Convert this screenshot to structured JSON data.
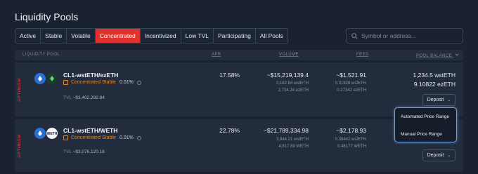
{
  "page": {
    "title": "Liquidity Pools"
  },
  "tabs": [
    {
      "label": "Active"
    },
    {
      "label": "Stable"
    },
    {
      "label": "Volatile"
    },
    {
      "label": "Concentrated"
    },
    {
      "label": "Incentivized"
    },
    {
      "label": "Low TVL"
    },
    {
      "label": "Participating"
    },
    {
      "label": "All Pools"
    }
  ],
  "active_tab": "Concentrated",
  "search": {
    "placeholder": "Symbol or address...",
    "value": ""
  },
  "table": {
    "headers": {
      "pool": "LIQUIDITY POOL",
      "apr": "APR",
      "volume": "VOLUME",
      "fees": "FEES",
      "balance": "POOL BALANCE"
    }
  },
  "rows": [
    {
      "network": "OPTIMISM",
      "name": "CL1-wstETH/ezETH",
      "type": "Concentrated Stable",
      "fee": "0.01%",
      "tvl_label": "TVL",
      "tvl": "~$3,402,292.84",
      "apr": "17.58%",
      "volume": "~$15,219,139.4",
      "volume_sub": [
        "3,182.84 wstETH",
        "2,734.24 ezETH"
      ],
      "fees": "~$1,521.91",
      "fees_sub": [
        "0.31828 wstETH",
        "0.27342 ezETH"
      ],
      "balance": [
        "1,234.5 wstETH",
        "9.10822 ezETH"
      ],
      "deposit_label": "Deposit"
    },
    {
      "network": "OPTIMISM",
      "name": "CL1-wstETH/WETH",
      "type": "Concentrated Stable",
      "fee": "0.01%",
      "tvl_label": "TVL",
      "tvl": "~$3,076,120.16",
      "apr": "22.78%",
      "volume": "~$21,789,334.98",
      "volume_sub": [
        "3,844.21 wstETH",
        "4,817.89 WETH"
      ],
      "fees": "~$2,178.93",
      "fees_sub": [
        "0.38442 wstETH",
        "0.48177 WETH"
      ],
      "deposit_label": "Deposit"
    }
  ],
  "deposit_menu": {
    "items": [
      "Automated Price Range",
      "Manual Price Range"
    ]
  },
  "colors": {
    "accent": "#e0312c",
    "type": "#e0872c",
    "focus_ring": "#6fa3e8",
    "background": "#1a2232",
    "panel": "#222c3d"
  }
}
